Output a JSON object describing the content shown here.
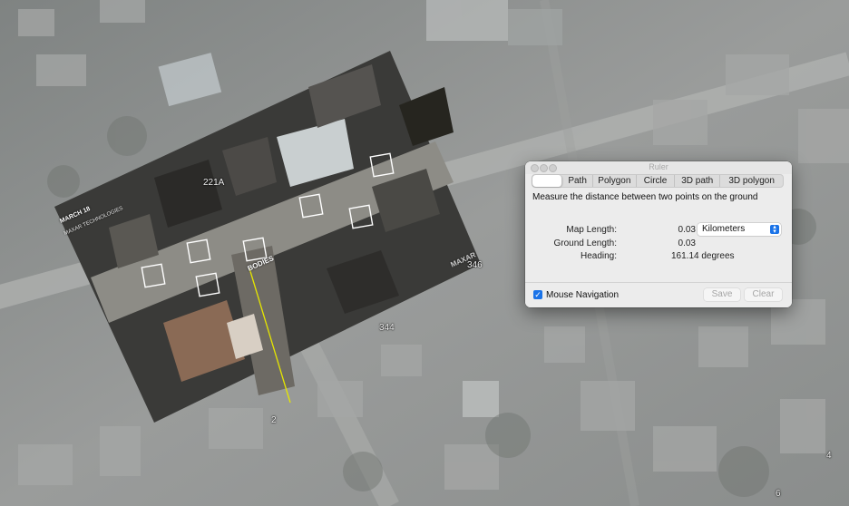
{
  "map": {
    "labels": [
      "221A",
      "346",
      "344",
      "2",
      "4",
      "6"
    ],
    "overlay": {
      "date_text": "MARCH 18",
      "company_text": "MAXAR TECHNOLOGIES",
      "annotation": "BODIES",
      "watermark": "MAXAR"
    }
  },
  "ruler": {
    "title": "Ruler",
    "tabs": [
      "",
      "Path",
      "Polygon",
      "Circle",
      "3D path",
      "3D polygon"
    ],
    "selected_tab_index": 0,
    "description": "Measure the distance between two points on the ground",
    "map_length_label": "Map Length:",
    "map_length_value": "0.03",
    "units_selected": "Kilometers",
    "ground_length_label": "Ground Length:",
    "ground_length_value": "0.03",
    "heading_label": "Heading:",
    "heading_value": "161.14 degrees",
    "mouse_navigation_label": "Mouse Navigation",
    "mouse_navigation_checked": true,
    "save_label": "Save",
    "clear_label": "Clear"
  },
  "colors": {
    "accent": "#1a73e8",
    "ruler_line": "#e6e600"
  }
}
